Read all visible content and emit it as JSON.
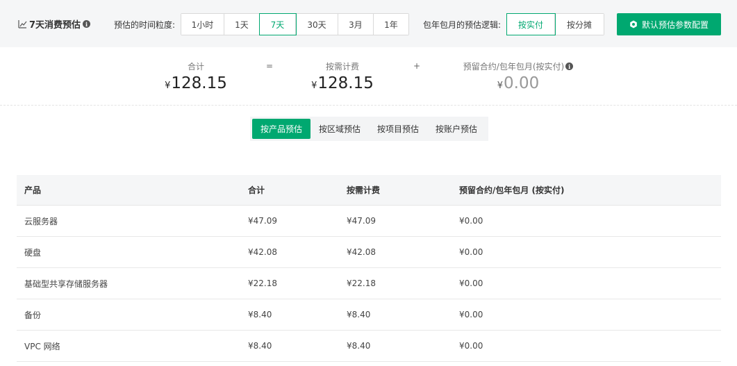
{
  "header": {
    "title": "7天消费预估",
    "info_icon": "i",
    "granularity_label": "预估的时间粒度:",
    "granularity_options": [
      "1小时",
      "1天",
      "7天",
      "30天",
      "3月",
      "1年"
    ],
    "granularity_selected": "7天",
    "logic_label": "包年包月的预估逻辑:",
    "logic_options": [
      "按实付",
      "按分摊"
    ],
    "logic_selected": "按实付",
    "config_button": "默认预估参数配置",
    "accent_color": "#00a870"
  },
  "summary": {
    "total_label": "合计",
    "total_currency": "¥",
    "total_value": "128.15",
    "equals": "=",
    "ondemand_label": "按需计费",
    "ondemand_currency": "¥",
    "ondemand_value": "128.15",
    "plus": "+",
    "reserved_label": "预留合约/包年包月(按实付)",
    "reserved_currency": "¥",
    "reserved_value": "0.00"
  },
  "tabs": {
    "items": [
      "按产品预估",
      "按区域预估",
      "按项目预估",
      "按账户预估"
    ],
    "selected": "按产品预估"
  },
  "table": {
    "headers": [
      "产品",
      "合计",
      "按需计费",
      "预留合约/包年包月 (按实付)"
    ],
    "rows": [
      [
        "云服务器",
        "¥47.09",
        "¥47.09",
        "¥0.00"
      ],
      [
        "硬盘",
        "¥42.08",
        "¥42.08",
        "¥0.00"
      ],
      [
        "基础型共享存储服务器",
        "¥22.18",
        "¥22.18",
        "¥0.00"
      ],
      [
        "备份",
        "¥8.40",
        "¥8.40",
        "¥0.00"
      ],
      [
        "VPC 网络",
        "¥8.40",
        "¥8.40",
        "¥0.00"
      ]
    ]
  }
}
